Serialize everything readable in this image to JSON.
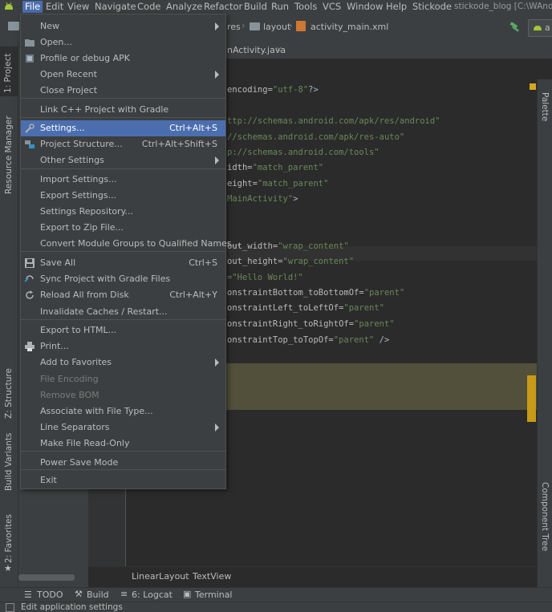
{
  "menubar": {
    "items": [
      {
        "label": "File"
      },
      {
        "label": "Edit"
      },
      {
        "label": "View"
      },
      {
        "label": "Navigate"
      },
      {
        "label": "Code"
      },
      {
        "label": "Analyze"
      },
      {
        "label": "Refactor"
      },
      {
        "label": "Build"
      },
      {
        "label": "Run"
      },
      {
        "label": "Tools"
      },
      {
        "label": "VCS"
      },
      {
        "label": "Window"
      },
      {
        "label": "Help"
      },
      {
        "label": "Stickode"
      }
    ],
    "window_title": "stickode_blog [C:\\WAndroi"
  },
  "toolbar": {
    "breadcrumb": [
      "res",
      "layout",
      "activity_main.xml"
    ],
    "device_label": "a"
  },
  "editor_tab": {
    "label": "nActivity.java"
  },
  "left_strip": {
    "project": "1: Project",
    "resource_manager": "Resource Manager",
    "structure": "Z: Structure",
    "build_variants": "Build Variants",
    "favorites": "2: Favorites"
  },
  "right_strip": {
    "palette": "Palette",
    "component_tree": "Component Tree"
  },
  "code_lines": [
    {
      "pre": "encoding=",
      "str": "\"utf-8\"",
      "post": "?>"
    },
    {
      "pre": "",
      "str": "ttp://schemas.android.com/apk/res/android\"",
      "post": ""
    },
    {
      "pre": "",
      "str": "//schemas.android.com/apk/res-auto\"",
      "post": ""
    },
    {
      "pre": "",
      "str": "p://schemas.android.com/tools\"",
      "post": ""
    },
    {
      "pre": "idth=",
      "str": "\"match_parent\"",
      "post": ""
    },
    {
      "pre": "eight=",
      "str": "\"match_parent\"",
      "post": ""
    },
    {
      "pre": "",
      "str": "MainActivity\"",
      "post": ">"
    },
    {
      "pre": "out_width=",
      "str": "\"wrap_content\"",
      "post": ""
    },
    {
      "pre": "out_height=",
      "str": "\"wrap_content\"",
      "post": ""
    },
    {
      "pre": "",
      "str": "=\"Hello World!\"",
      "post": ""
    },
    {
      "pre": "onstraintBottom_toBottomOf=",
      "str": "\"parent\"",
      "post": ""
    },
    {
      "pre": "onstraintLeft_toLeftOf=",
      "str": "\"parent\"",
      "post": ""
    },
    {
      "pre": "onstraintRight_toRightOf=",
      "str": "\"parent\"",
      "post": ""
    },
    {
      "pre": "onstraintTop_toTopOf=",
      "str": "\"parent\"",
      "post": " />"
    }
  ],
  "bottom_breadcrumb": [
    "LinearLayout",
    "TextView"
  ],
  "bottom_tools": [
    {
      "label": "TODO"
    },
    {
      "label": "Build"
    },
    {
      "label": "6: Logcat"
    },
    {
      "label": "Terminal"
    }
  ],
  "status": {
    "text": "Edit application settings"
  },
  "file_menu": {
    "items": [
      {
        "label": "New",
        "shortcut": "",
        "submenu": true,
        "icon": "",
        "disabled": false
      },
      {
        "label": "Open...",
        "shortcut": "",
        "submenu": false,
        "icon": "folder-icon",
        "disabled": false
      },
      {
        "label": "Profile or debug APK",
        "shortcut": "",
        "submenu": false,
        "icon": "apk-icon",
        "disabled": false
      },
      {
        "label": "Open Recent",
        "shortcut": "",
        "submenu": true,
        "icon": "",
        "disabled": false
      },
      {
        "label": "Close Project",
        "shortcut": "",
        "submenu": false,
        "icon": "",
        "disabled": false
      },
      {
        "label": "Link C++ Project with Gradle",
        "shortcut": "",
        "submenu": false,
        "icon": "",
        "disabled": false
      },
      {
        "label": "Settings...",
        "shortcut": "Ctrl+Alt+S",
        "submenu": false,
        "icon": "wrench-icon",
        "disabled": false,
        "selected": true
      },
      {
        "label": "Project Structure...",
        "shortcut": "Ctrl+Alt+Shift+S",
        "submenu": false,
        "icon": "project-structure-icon",
        "disabled": false
      },
      {
        "label": "Other Settings",
        "shortcut": "",
        "submenu": true,
        "icon": "",
        "disabled": false
      },
      {
        "label": "Import Settings...",
        "shortcut": "",
        "submenu": false,
        "icon": "",
        "disabled": false
      },
      {
        "label": "Export Settings...",
        "shortcut": "",
        "submenu": false,
        "icon": "",
        "disabled": false
      },
      {
        "label": "Settings Repository...",
        "shortcut": "",
        "submenu": false,
        "icon": "",
        "disabled": false
      },
      {
        "label": "Export to Zip File...",
        "shortcut": "",
        "submenu": false,
        "icon": "",
        "disabled": false
      },
      {
        "label": "Convert Module Groups to Qualified Names...",
        "shortcut": "",
        "submenu": false,
        "icon": "",
        "disabled": false
      },
      {
        "label": "Save All",
        "shortcut": "Ctrl+S",
        "submenu": false,
        "icon": "save-icon",
        "disabled": false
      },
      {
        "label": "Sync Project with Gradle Files",
        "shortcut": "",
        "submenu": false,
        "icon": "sync-icon",
        "disabled": false
      },
      {
        "label": "Reload All from Disk",
        "shortcut": "Ctrl+Alt+Y",
        "submenu": false,
        "icon": "reload-icon",
        "disabled": false
      },
      {
        "label": "Invalidate Caches / Restart...",
        "shortcut": "",
        "submenu": false,
        "icon": "",
        "disabled": false
      },
      {
        "label": "Export to HTML...",
        "shortcut": "",
        "submenu": false,
        "icon": "",
        "disabled": false
      },
      {
        "label": "Print...",
        "shortcut": "",
        "submenu": false,
        "icon": "print-icon",
        "disabled": false
      },
      {
        "label": "Add to Favorites",
        "shortcut": "",
        "submenu": true,
        "icon": "",
        "disabled": false
      },
      {
        "label": "File Encoding",
        "shortcut": "",
        "submenu": false,
        "icon": "",
        "disabled": true
      },
      {
        "label": "Remove BOM",
        "shortcut": "",
        "submenu": false,
        "icon": "",
        "disabled": true
      },
      {
        "label": "Associate with File Type...",
        "shortcut": "",
        "submenu": false,
        "icon": "",
        "disabled": false
      },
      {
        "label": "Line Separators",
        "shortcut": "",
        "submenu": true,
        "icon": "",
        "disabled": false
      },
      {
        "label": "Make File Read-Only",
        "shortcut": "",
        "submenu": false,
        "icon": "",
        "disabled": false
      },
      {
        "label": "Power Save Mode",
        "shortcut": "",
        "submenu": false,
        "icon": "",
        "disabled": false
      },
      {
        "label": "Exit",
        "shortcut": "",
        "submenu": false,
        "icon": "",
        "disabled": false
      }
    ]
  },
  "colors": {
    "menu_bg": "#3c3f41",
    "selection": "#4b6eaf",
    "editor_bg": "#2b2b2b",
    "string": "#6a8759",
    "android_green": "#a4c639"
  }
}
